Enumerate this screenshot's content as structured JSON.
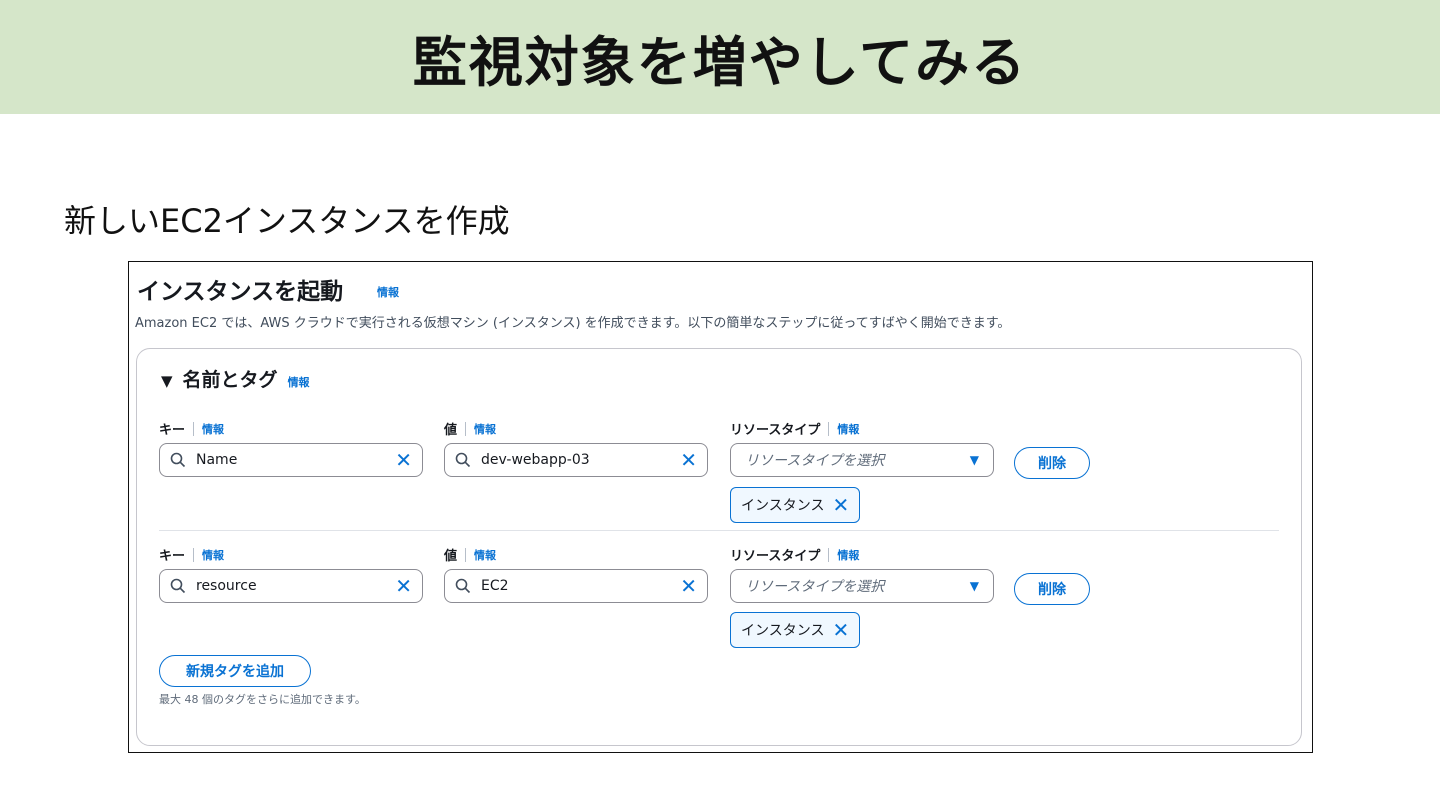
{
  "slide": {
    "title": "監視対象を増やしてみる",
    "subtitle": "新しいEC2インスタンスを作成"
  },
  "launch": {
    "title": "インスタンスを起動",
    "info": "情報",
    "description": "Amazon EC2 では、AWS クラウドで実行される仮想マシン (インスタンス) を作成できます。以下の簡単なステップに従ってすばやく開始できます。"
  },
  "panel": {
    "caret": "▼",
    "title": "名前とタグ",
    "info": "情報",
    "add_tag_label": "新規タグを追加",
    "hint": "最大 48 個のタグをさらに追加できます。"
  },
  "labels": {
    "key": "キー",
    "value": "値",
    "resource_type": "リソースタイプ",
    "info": "情報",
    "select_placeholder": "リソースタイプを選択",
    "remove": "削除"
  },
  "tags": [
    {
      "key": "Name",
      "value": "dev-webapp-03",
      "token": "インスタンス"
    },
    {
      "key": "resource",
      "value": "EC2",
      "token": "インスタンス"
    }
  ],
  "icons": {
    "search": "search-icon",
    "clear": "close-icon",
    "dropdown": "caret-down-icon",
    "token_remove": "close-icon"
  },
  "colors": {
    "banner": "#d5e6c9",
    "accent": "#0972d3",
    "text": "#16191f"
  }
}
